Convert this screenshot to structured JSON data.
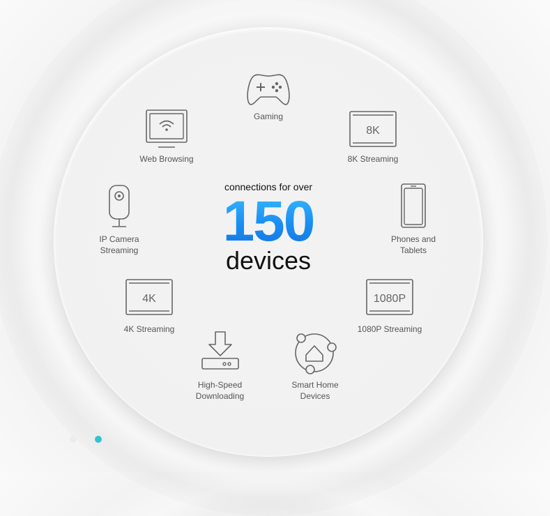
{
  "center": {
    "intro": "connections for over",
    "number": "150",
    "unit": "devices"
  },
  "items": [
    {
      "label": "Gaming",
      "icon": "gamepad-icon"
    },
    {
      "label": "8K Streaming",
      "icon": "tv-8k-icon",
      "badge": "8K"
    },
    {
      "label": "Phones and\nTablets",
      "icon": "phone-icon"
    },
    {
      "label": "1080P Streaming",
      "icon": "tv-1080p-icon",
      "badge": "1080P"
    },
    {
      "label": "Smart Home\nDevices",
      "icon": "smart-home-icon"
    },
    {
      "label": "High-Speed\nDownloading",
      "icon": "download-icon"
    },
    {
      "label": "4K Streaming",
      "icon": "tv-4k-icon",
      "badge": "4K"
    },
    {
      "label": "IP Camera\nStreaming",
      "icon": "ip-camera-icon"
    },
    {
      "label": "Web Browsing",
      "icon": "monitor-wifi-icon"
    }
  ],
  "carousel": {
    "active_index": 1,
    "colors": {
      "active": "#2ec4d6",
      "inactive": "#ececec"
    }
  }
}
